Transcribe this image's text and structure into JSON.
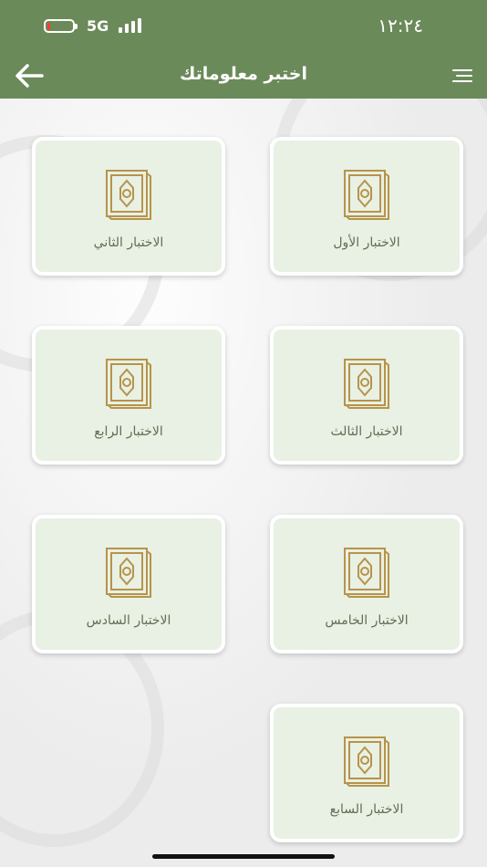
{
  "status_bar": {
    "time": "١٢:٢٤",
    "network": "5G",
    "battery_level": 0.1,
    "signal_bars": 4
  },
  "header": {
    "title": "اختبر معلوماتك",
    "back_icon": "arrow-left-icon",
    "menu_icon": "menu-icon"
  },
  "colors": {
    "header_bg": "#6b8a5a",
    "card_bg": "#e8f1e4",
    "icon_gold": "#b8934a",
    "label_color": "#5f6e53"
  },
  "quizzes": [
    {
      "label": "الاختبار الأول",
      "icon": "book-icon"
    },
    {
      "label": "الاختبار الثاني",
      "icon": "book-icon"
    },
    {
      "label": "الاختبار الثالث",
      "icon": "book-icon"
    },
    {
      "label": "الاختبار الرابع",
      "icon": "book-icon"
    },
    {
      "label": "الاختبار الخامس",
      "icon": "book-icon"
    },
    {
      "label": "الاختبار السادس",
      "icon": "book-icon"
    },
    {
      "label": "الاختبار السابع",
      "icon": "book-icon"
    }
  ]
}
